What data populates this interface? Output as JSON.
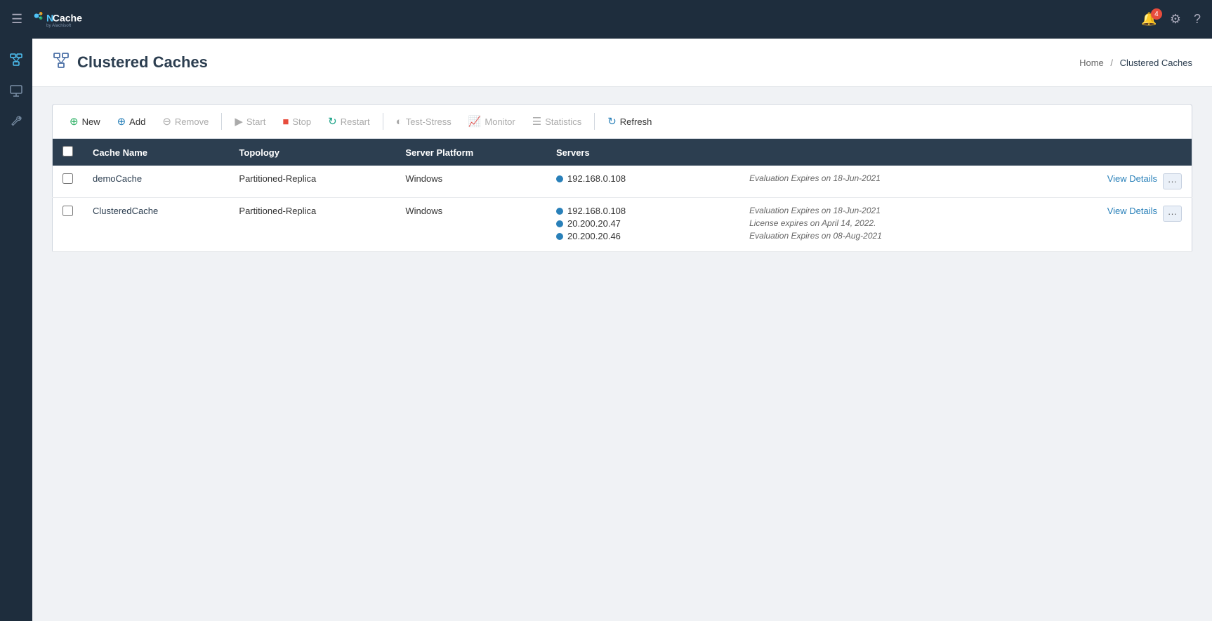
{
  "app": {
    "title": "NCache by Alachisoft",
    "notification_count": "4"
  },
  "breadcrumb": {
    "home": "Home",
    "separator": "/",
    "current": "Clustered Caches"
  },
  "page": {
    "title": "Clustered Caches",
    "icon": "cluster-icon"
  },
  "toolbar": {
    "new_label": "New",
    "add_label": "Add",
    "remove_label": "Remove",
    "start_label": "Start",
    "stop_label": "Stop",
    "restart_label": "Restart",
    "test_stress_label": "Test-Stress",
    "monitor_label": "Monitor",
    "statistics_label": "Statistics",
    "refresh_label": "Refresh"
  },
  "table": {
    "headers": [
      "",
      "Cache Name",
      "Topology",
      "Server Platform",
      "Servers",
      "",
      ""
    ],
    "rows": [
      {
        "id": "demoCache",
        "cache_name": "demoCache",
        "topology": "Partitioned-Replica",
        "server_platform": "Windows",
        "servers": [
          {
            "ip": "192.168.0.108",
            "status": "active"
          }
        ],
        "expiry": [
          "Evaluation Expires on 18-Jun-2021"
        ],
        "view_details": "View Details"
      },
      {
        "id": "ClusteredCache",
        "cache_name": "ClusteredCache",
        "topology": "Partitioned-Replica",
        "server_platform": "Windows",
        "servers": [
          {
            "ip": "192.168.0.108",
            "status": "active"
          },
          {
            "ip": "20.200.20.47",
            "status": "active"
          },
          {
            "ip": "20.200.20.46",
            "status": "active"
          }
        ],
        "expiry": [
          "Evaluation Expires on 18-Jun-2021",
          "License expires on April 14, 2022.",
          "Evaluation Expires on 08-Aug-2021"
        ],
        "view_details": "View Details"
      }
    ]
  },
  "sidebar": {
    "items": [
      {
        "name": "clustered-caches",
        "icon": "⊞"
      },
      {
        "name": "monitors",
        "icon": "🖥"
      },
      {
        "name": "tools",
        "icon": "🔧"
      }
    ]
  }
}
